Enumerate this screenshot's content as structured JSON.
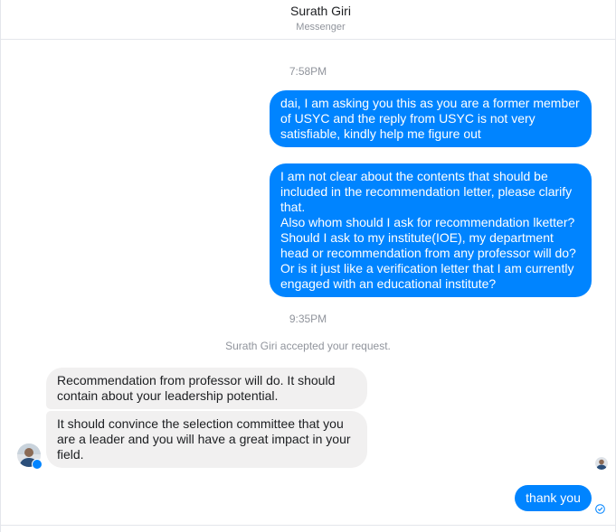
{
  "header": {
    "name": "Surath Giri",
    "subtitle": "Messenger"
  },
  "timestamps": [
    "7:58PM",
    "9:35PM"
  ],
  "system_message": "Surath Giri accepted your request.",
  "messages": {
    "out1": {
      "lines": [
        "dai, I am asking you this as you are a former member",
        "of USYC and the reply from USYC is not very",
        "satisfiable, kindly help me figure out"
      ]
    },
    "out2": {
      "lines": [
        "I am not clear about the contents that should be",
        "included in the recommendation letter, please clarify",
        "that.",
        "Also whom should I ask for recommendation lketter?",
        "Should I ask to my institute(IOE), my department",
        "head or recommendation from any professor will do?",
        "Or is it just like a verification letter that I am currently",
        "engaged with an educational institute?"
      ]
    },
    "in1": {
      "lines": [
        "Recommendation from professor will do. It should",
        "contain about your leadership potential."
      ]
    },
    "in2": {
      "lines": [
        "It should convince the selection committee that you",
        "are a leader and you will have a great impact in your",
        "field."
      ]
    },
    "out3": {
      "lines": [
        "thank you"
      ]
    }
  },
  "icons": {
    "contact_avatar": "avatar-icon",
    "messenger_badge": "messenger-badge-icon",
    "seen_avatar": "seen-avatar-icon",
    "sent_status": "sent-check-icon"
  },
  "colors": {
    "outgoing_bubble": "#0084ff",
    "incoming_bubble": "#f1f0f0",
    "meta_text": "#90949c"
  }
}
